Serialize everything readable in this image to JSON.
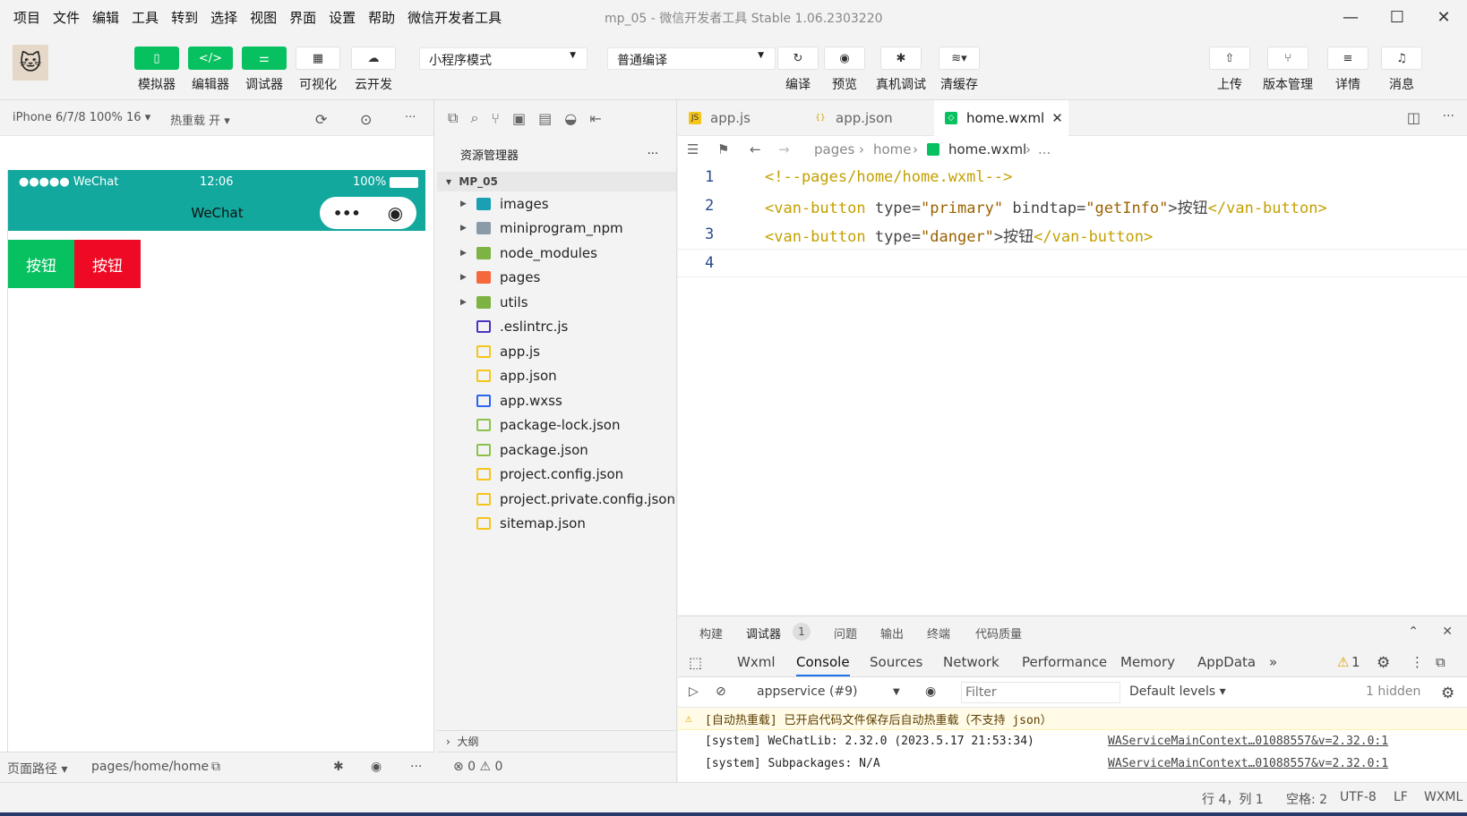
{
  "menubar": {
    "items": [
      "项目",
      "文件",
      "编辑",
      "工具",
      "转到",
      "选择",
      "视图",
      "界面",
      "设置",
      "帮助",
      "微信开发者工具"
    ],
    "title": "mp_05",
    "subtitle": "- 微信开发者工具 Stable 1.06.2303220",
    "min": "—",
    "max": "☐",
    "close": "✕"
  },
  "toolbar": {
    "simulator": "模拟器",
    "editor": "编辑器",
    "debugger": "调试器",
    "visual": "可视化",
    "cloud": "云开发",
    "mode": "小程序模式",
    "compile_mode": "普通编译",
    "compile": "编译",
    "preview": "预览",
    "real_debug": "真机调试",
    "clear_cache": "清缓存",
    "upload": "上传",
    "version": "版本管理",
    "detail": "详情",
    "message": "消息"
  },
  "sim": {
    "device": "iPhone 6/7/8 100% 16 ▾",
    "hotreload": "热重载 开 ▾",
    "status_carrier": "●●●●● WeChat",
    "status_time": "12:06",
    "status_battery": "100%",
    "nav_title": "WeChat",
    "btn_primary": "按钮",
    "btn_danger": "按钮",
    "colors": {
      "primary": "#07c160",
      "danger": "#ee0a24",
      "nav": "#13a89e"
    }
  },
  "leftfoot": {
    "path_label": "页面路径 ▾",
    "path": "pages/home/home"
  },
  "explorer": {
    "title": "资源管理器",
    "more": "···",
    "project": "MP_05",
    "items": [
      {
        "name": "images",
        "type": "folder",
        "icon": "image-folder-icon",
        "color": "#1a9fb5"
      },
      {
        "name": "miniprogram_npm",
        "type": "folder",
        "icon": "folder-icon",
        "color": "#8a9aa8"
      },
      {
        "name": "node_modules",
        "type": "folder",
        "icon": "node-folder-icon",
        "color": "#7cb342"
      },
      {
        "name": "pages",
        "type": "folder",
        "icon": "pages-folder-icon",
        "color": "#f4683c"
      },
      {
        "name": "utils",
        "type": "folder",
        "icon": "utils-folder-icon",
        "color": "#7cb342"
      },
      {
        "name": ".eslintrc.js",
        "type": "file",
        "icon": "eslint-icon",
        "color": "#4b32c3"
      },
      {
        "name": "app.js",
        "type": "file",
        "icon": "js-icon",
        "color": "#f5c518"
      },
      {
        "name": "app.json",
        "type": "file",
        "icon": "json-icon",
        "color": "#f5c518"
      },
      {
        "name": "app.wxss",
        "type": "file",
        "icon": "css-icon",
        "color": "#2965f1"
      },
      {
        "name": "package-lock.json",
        "type": "file",
        "icon": "npm-json-icon",
        "color": "#8bc34a"
      },
      {
        "name": "package.json",
        "type": "file",
        "icon": "npm-json-icon",
        "color": "#8bc34a"
      },
      {
        "name": "project.config.json",
        "type": "file",
        "icon": "json-icon",
        "color": "#f5c518"
      },
      {
        "name": "project.private.config.json",
        "type": "file",
        "icon": "json-icon",
        "color": "#f5c518"
      },
      {
        "name": "sitemap.json",
        "type": "file",
        "icon": "json-icon",
        "color": "#f5c518"
      }
    ],
    "outline": "大纲",
    "errors": "⊗ 0 ⚠ 0"
  },
  "editor": {
    "tabs": [
      "app.js",
      "app.json",
      "home.wxml"
    ],
    "tab_close": "✕",
    "crumbs": [
      "pages",
      "home",
      "home.wxml",
      "..."
    ],
    "lines": [
      {
        "n": "1",
        "parts": [
          {
            "c": "cmt",
            "t": "<!--pages/home/home.wxml-->"
          }
        ]
      },
      {
        "n": "2",
        "parts": [
          {
            "c": "tag",
            "t": "<van-button"
          },
          {
            "c": "attr",
            "t": " type="
          },
          {
            "c": "str",
            "t": "\"primary\""
          },
          {
            "c": "attr",
            "t": " bindtap="
          },
          {
            "c": "str",
            "t": "\"getInfo\""
          },
          {
            "c": "attr",
            "t": ">按钮"
          },
          {
            "c": "tag",
            "t": "</van-button>"
          }
        ]
      },
      {
        "n": "3",
        "parts": [
          {
            "c": "tag",
            "t": "<van-button"
          },
          {
            "c": "attr",
            "t": " type="
          },
          {
            "c": "str",
            "t": "\"danger\""
          },
          {
            "c": "attr",
            "t": ">按钮"
          },
          {
            "c": "tag",
            "t": "</van-button>"
          }
        ]
      },
      {
        "n": "4",
        "parts": []
      }
    ]
  },
  "devtools": {
    "top_tabs": [
      "构建",
      "调试器",
      "问题",
      "输出",
      "终端",
      "代码质量"
    ],
    "debugger_badge": "1",
    "tabs": [
      "Wxml",
      "Console",
      "Sources",
      "Network",
      "Performance",
      "Memory",
      "AppData",
      "»"
    ],
    "warn_count": "1",
    "context": "appservice (#9)",
    "filter_placeholder": "Filter",
    "levels": "Default levels ▾",
    "hidden": "1 hidden",
    "logs": [
      {
        "type": "warn",
        "text": "[自动热重载] 已开启代码文件保存后自动热重载（不支持 json）",
        "link": ""
      },
      {
        "type": "log",
        "text": "[system] WeChatLib: 2.32.0 (2023.5.17 21:53:34)",
        "link": "WAServiceMainContext…01088557&v=2.32.0:1"
      },
      {
        "type": "log",
        "text": "[system] Subpackages: N/A",
        "link": "WAServiceMainContext…01088557&v=2.32.0:1"
      }
    ]
  },
  "statusbar": {
    "pos": "行 4，列 1",
    "spaces": "空格: 2",
    "enc": "UTF-8",
    "eol": "LF",
    "lang": "WXML"
  }
}
